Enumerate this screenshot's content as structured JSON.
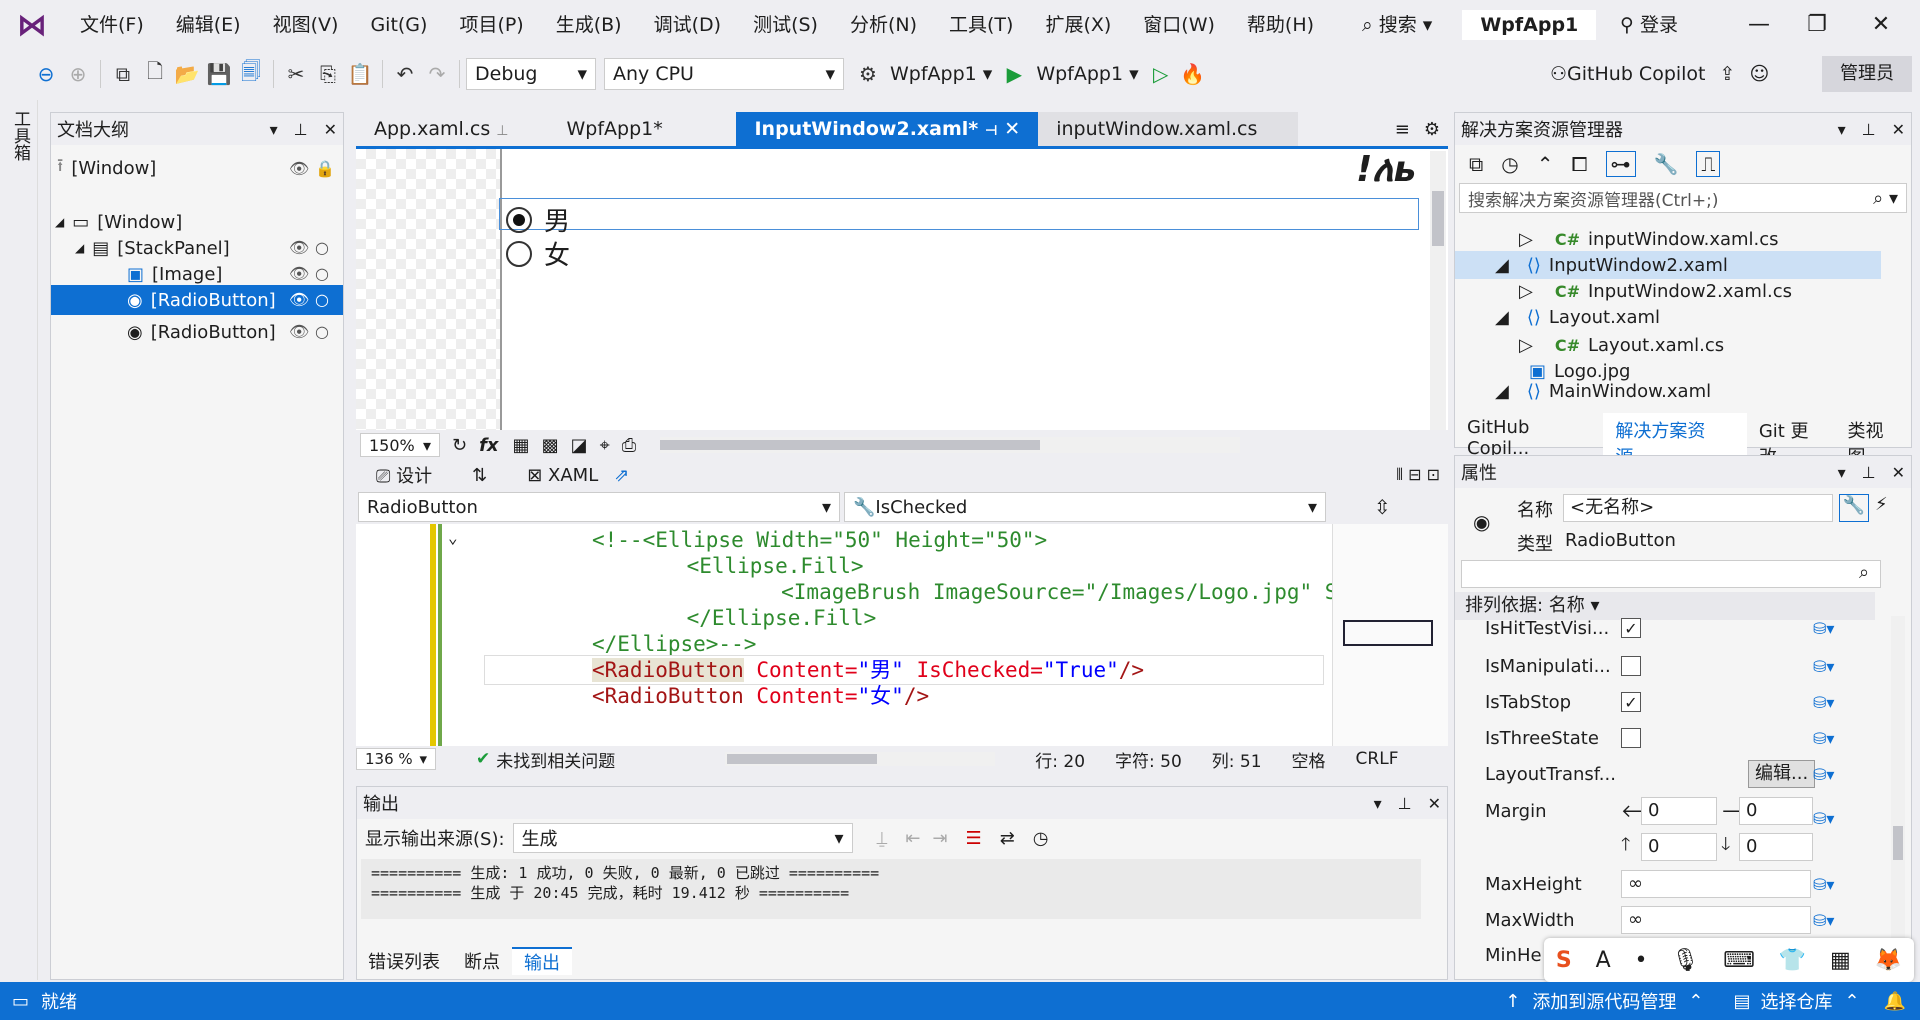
{
  "app": {
    "title": "WpfApp1",
    "login": "登录",
    "admin": "管理员"
  },
  "menu": [
    "文件(F)",
    "编辑(E)",
    "视图(V)",
    "Git(G)",
    "项目(P)",
    "生成(B)",
    "调试(D)",
    "测试(S)",
    "分析(N)",
    "工具(T)",
    "扩展(X)",
    "窗口(W)",
    "帮助(H)"
  ],
  "search": {
    "label": "搜索"
  },
  "toolbar": {
    "config": "Debug",
    "platform": "Any CPU",
    "startup_project": "WpfApp1",
    "run_target": "WpfApp1",
    "copilot": "GitHub Copilot"
  },
  "toolbox": {
    "label": "工具箱"
  },
  "outline": {
    "title": "文档大纲",
    "items": [
      {
        "label": "[Window]"
      },
      {
        "label": "[Window]"
      },
      {
        "label": "[StackPanel]"
      },
      {
        "label": "[Image]"
      },
      {
        "label": "[RadioButton]"
      },
      {
        "label": "[RadioButton]"
      }
    ]
  },
  "tabs": [
    "App.xaml.cs",
    "WpfApp1*",
    "InputWindow2.xaml*",
    "inputWindow.xaml.cs"
  ],
  "designer": {
    "radios": [
      {
        "label": "男",
        "checked": true
      },
      {
        "label": "女",
        "checked": false
      }
    ],
    "zoom": "150%",
    "logo_text": "!ለь"
  },
  "views": {
    "design": "设计",
    "xaml": "XAML"
  },
  "xaml_combos": {
    "element": "RadioButton",
    "property": "IsChecked"
  },
  "code": {
    "lines": [
      "<!--<Ellipse Width=\"50\" Height=\"50\">",
      "    <Ellipse.Fill>",
      "        <ImageBrush ImageSource=\"/Images/Logo.jpg\" Stret",
      "    </Ellipse.Fill>",
      "</Ellipse>-->"
    ],
    "rb1": {
      "tag": "<RadioButton",
      "a1": " Content=",
      "v1": "\"男\"",
      "a2": " IsChecked=",
      "v2": "\"True\"",
      "end": "/>"
    },
    "rb2": {
      "tag": "<RadioButton",
      "a1": " Content=",
      "v1": "\"女\"",
      "end": "/>"
    }
  },
  "code_status": {
    "zoom": "136 %",
    "issues": "未找到相关问题",
    "line": "行: 20",
    "char": "字符: 50",
    "col": "列: 51",
    "space": "空格",
    "eol": "CRLF"
  },
  "output": {
    "title": "输出",
    "source_label": "显示输出来源(S):",
    "source": "生成",
    "text": "========== 生成: 1 成功, 0 失败, 0 最新, 0 已跳过 ==========\n========== 生成 于 20:45 完成，耗时 19.412 秒 =========="
  },
  "bottom_tabs": [
    "错误列表",
    "断点",
    "输出"
  ],
  "solution": {
    "title": "解决方案资源管理器",
    "search_placeholder": "搜索解决方案资源管理器(Ctrl+;)",
    "items": [
      "inputWindow.xaml.cs",
      "InputWindow2.xaml",
      "InputWindow2.xaml.cs",
      "Layout.xaml",
      "Layout.xaml.cs",
      "Logo.jpg",
      "MainWindow.xaml"
    ],
    "tabs": [
      "GitHub Copil...",
      "解决方案资源...",
      "Git 更改",
      "类视图"
    ]
  },
  "properties": {
    "title": "属性",
    "name_label": "名称",
    "name_value": "<无名称>",
    "type_label": "类型",
    "type_value": "RadioButton",
    "sort_label": "排列依据: 名称",
    "rows": {
      "hittest": "IsHitTestVisi...",
      "manip": "IsManipulati...",
      "tabstop": "IsTabStop",
      "three": "IsThreeState",
      "layout": "LayoutTransf...",
      "margin": "Margin",
      "maxh": "MaxHeight",
      "maxw": "MaxWidth",
      "minh": "MinHe"
    },
    "edit_btn": "编辑...",
    "margin_vals": [
      "0",
      "0",
      "0",
      "0"
    ],
    "inf": "∞"
  },
  "status": {
    "ready": "就绪",
    "source_control": "添加到源代码管理",
    "repo": "选择仓库"
  },
  "colors": {
    "accent": "#0e6fd2",
    "status_bar": "#0e6fd2"
  }
}
